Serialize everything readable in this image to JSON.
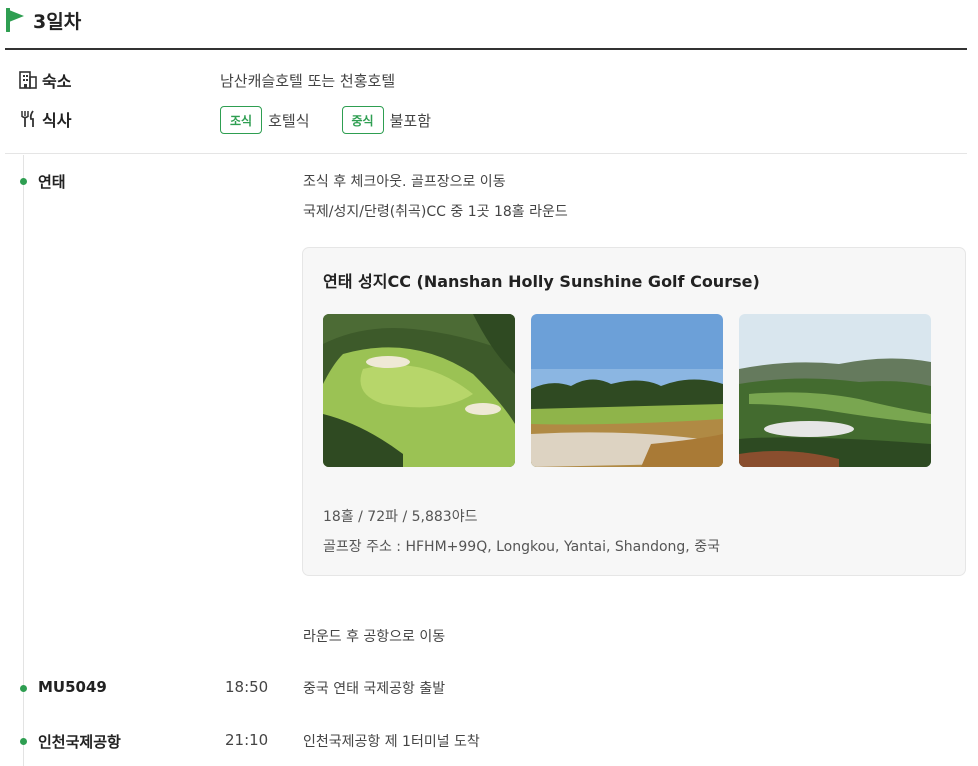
{
  "day": {
    "title": "3일차",
    "flag_icon": "flag-icon",
    "accent_color": "#2e9e51"
  },
  "accommodation": {
    "label": "숙소",
    "icon": "building-icon",
    "value": "남산캐슬호텔 또는 천홍호텔"
  },
  "meals": {
    "label": "식사",
    "icon": "fork-knife-icon",
    "items": [
      {
        "badge": "조식",
        "text": "호텔식"
      },
      {
        "badge": "중식",
        "text": "불포함"
      }
    ]
  },
  "stops": [
    {
      "name": "연태",
      "time": "",
      "lines": [
        "조식 후 체크아웃. 골프장으로 이동",
        "국제/성지/단령(취곡)CC 중 1곳 18홀 라운드"
      ],
      "after": "라운드 후 공항으로 이동"
    },
    {
      "name": "MU5049",
      "time": "18:50",
      "lines": [
        "중국 연태 국제공항 출발"
      ]
    },
    {
      "name": "인천국제공항",
      "time": "21:10",
      "lines": [
        "인천국제공항 제 1터미널 도착"
      ]
    }
  ],
  "course": {
    "title": "연태 성지CC (Nanshan Holly Sunshine Golf Course)",
    "photos": [
      "golf-course-photo-1",
      "golf-course-photo-2",
      "golf-course-photo-3"
    ],
    "spec": "18홀 / 72파 / 5,883야드",
    "address": "골프장 주소 : HFHM+99Q, Longkou, Yantai, Shandong, 중국"
  }
}
